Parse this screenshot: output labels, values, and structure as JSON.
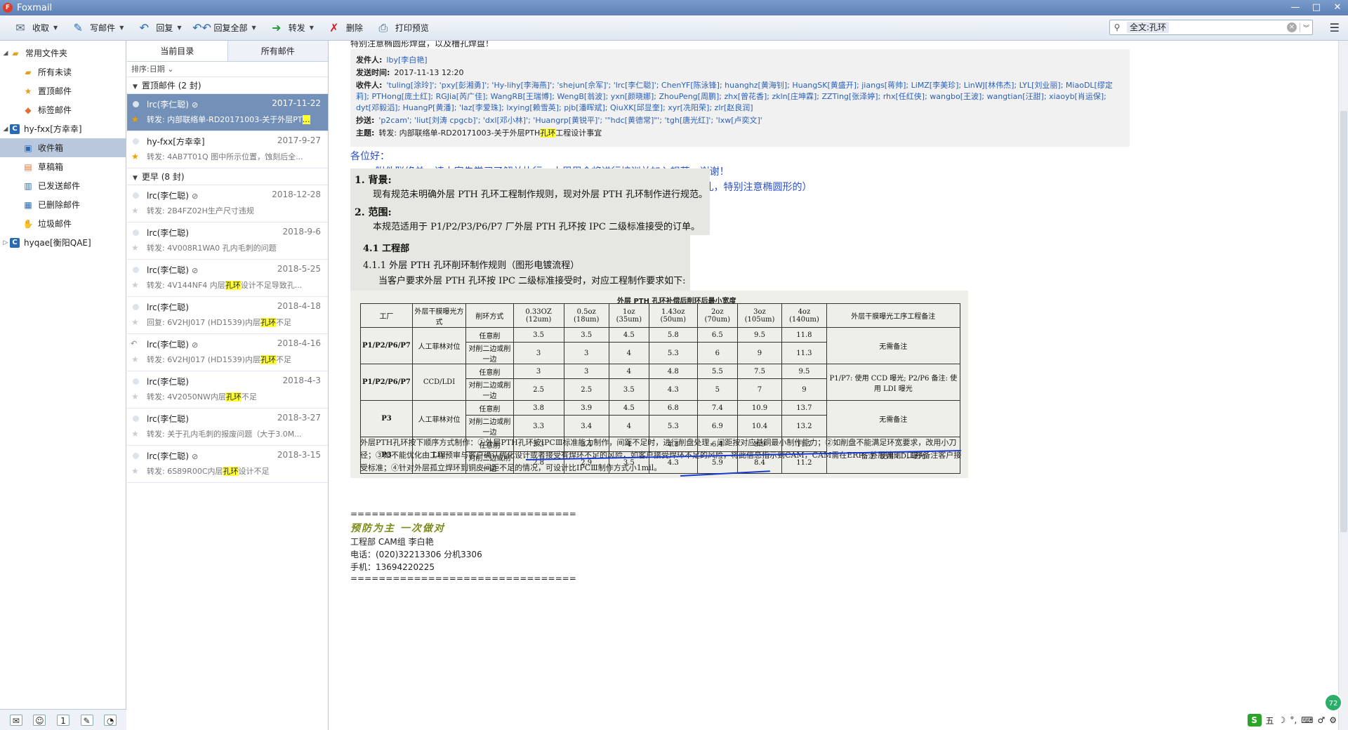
{
  "window": {
    "title": "Foxmail",
    "controls": [
      "—",
      "□",
      "✕"
    ]
  },
  "toolbar": {
    "buttons": [
      {
        "label": "收取",
        "icon": "inbox-receive-icon",
        "dropdown": true
      },
      {
        "label": "写邮件",
        "icon": "compose-pen-icon",
        "dropdown": true
      },
      {
        "label": "回复",
        "icon": "reply-arrow-icon",
        "dropdown": true
      },
      {
        "label": "回复全部",
        "icon": "reply-all-icon",
        "dropdown": true
      },
      {
        "label": "转发",
        "icon": "forward-arrow-icon",
        "dropdown": true
      },
      {
        "label": "删除",
        "icon": "delete-x-icon",
        "dropdown": false
      },
      {
        "label": "打印预览",
        "icon": "print-icon",
        "dropdown": false
      }
    ],
    "search_value": "全文:孔环"
  },
  "sidebar": {
    "items": [
      {
        "label": "常用文件夹",
        "level": 0,
        "icon": "folder-icon",
        "arrow": "◢"
      },
      {
        "label": "所有未读",
        "level": 1,
        "icon": "folder-icon"
      },
      {
        "label": "置顶邮件",
        "level": 1,
        "icon": "star-icon"
      },
      {
        "label": "标签邮件",
        "level": 1,
        "icon": "tag-icon"
      },
      {
        "label": "hy-fxx[方幸幸]",
        "level": 0,
        "icon": "account-icon",
        "arrow": "◢"
      },
      {
        "label": "收件箱",
        "level": 1,
        "icon": "inbox-icon",
        "selected": true
      },
      {
        "label": "草稿箱",
        "level": 1,
        "icon": "drafts-icon"
      },
      {
        "label": "已发送邮件",
        "level": 1,
        "icon": "sent-icon"
      },
      {
        "label": "已删除邮件",
        "level": 1,
        "icon": "trash-icon"
      },
      {
        "label": "垃圾邮件",
        "level": 1,
        "icon": "spam-icon"
      },
      {
        "label": "hyqae[衡阳QAE]",
        "level": 0,
        "icon": "account-icon",
        "arrow": "▷"
      }
    ]
  },
  "list": {
    "tabs": [
      "当前目录",
      "所有邮件"
    ],
    "sort_label": "排序:日期",
    "groups": [
      {
        "label": "置顶邮件 (2 封)",
        "items": [
          {
            "sender": "lrc(李仁聪)",
            "date": "2017-11-22",
            "subject_pre": "转发: 内部联络单-RD20171003-关于外层PT",
            "subject_hl": "…",
            "subject_post": "",
            "attach": true,
            "star": true,
            "selected": true
          },
          {
            "sender": "hy-fxx[方幸幸]",
            "date": "2017-9-27",
            "subject_pre": "转发: 4AB7T01Q 图中所示位置，蚀刻后全...",
            "subject_hl": "",
            "subject_post": "",
            "attach": false,
            "star": true
          }
        ]
      },
      {
        "label": "更早 (8 封)",
        "items": [
          {
            "sender": "lrc(李仁聪)",
            "date": "2018-12-28",
            "subject_pre": "转发: 2B4FZ02H生产尺寸违规",
            "subject_hl": "",
            "subject_post": "",
            "attach": true
          },
          {
            "sender": "lrc(李仁聪)",
            "date": "2018-9-6",
            "subject_pre": "转发: 4V008R1WA0  孔内毛刺的问题",
            "subject_hl": "",
            "subject_post": "",
            "attach": false
          },
          {
            "sender": "lrc(李仁聪)",
            "date": "2018-5-25",
            "subject_pre": "转发: 4V144NF4   内层",
            "subject_hl": "孔环",
            "subject_post": "设计不足导致孔...",
            "attach": true
          },
          {
            "sender": "lrc(李仁聪)",
            "date": "2018-4-18",
            "subject_pre": "回复: 6V2HJ017  (HD1539)内层",
            "subject_hl": "孔环",
            "subject_post": "不足",
            "attach": false
          },
          {
            "sender": "lrc(李仁聪)",
            "date": "2018-4-16",
            "subject_pre": "转发: 6V2HJ017  (HD1539)内层",
            "subject_hl": "孔环",
            "subject_post": "不足",
            "attach": true,
            "replied": true
          },
          {
            "sender": "lrc(李仁聪)",
            "date": "2018-4-3",
            "subject_pre": "转发: 4V2050NW内层",
            "subject_hl": "孔环",
            "subject_post": "不足",
            "attach": false
          },
          {
            "sender": "lrc(李仁聪)",
            "date": "2018-3-27",
            "subject_pre": "转发: 关于孔内毛刺的报废问题（大于3.0M...",
            "subject_hl": "",
            "subject_post": "",
            "attach": false
          },
          {
            "sender": "lrc(李仁聪)",
            "date": "2018-3-15",
            "subject_pre": "转发: 6S89R00C内层",
            "subject_hl": "孔环",
            "subject_post": "设计不足",
            "attach": true
          }
        ]
      }
    ]
  },
  "mail": {
    "cut_line": "特别注意椭圆形焊盘，以及槽孔焊盘！",
    "from_label": "发件人:",
    "from": "lby[李白艳]",
    "time_label": "发送时间:",
    "time": "2017-11-13 12:20",
    "to_label": "收件人:",
    "to": "'tuling[涂玲]'; 'pxy[彭湘勇]'; 'Hy-lihy[李海燕]'; 'shejun[佘军]'; 'lrc[李仁聪]'; ChenYF[陈泳锋]; huanghz[黄海钊]; HuangSK[黄盛开]; jiangs[蒋帅]; LiMZ[李美珍]; LinWJ[林伟杰]; LYL[刘业丽]; MiaoDL[缪定莉]; PTHong[庞土红]; RGJia[芮广佳]; WangRB[王瑞博]; WengB[翁波]; yxn[颜晓娜]; ZhouPeng[周鹏]; zhx[曾花香]; zkln[庄坤霖]; ZZTing[张泽婷]; rhx[任红侠]; wangbo[王波]; wangtian[汪甜]; xiaoyb[肖运保]; dyt[邓毅滔]; HuangP[黄潘]; 'laz[李爱珠]; lxying[赖雪英]; pjb[潘晖斌]; QiuXK[邱显奎]; xyr[冼阳荣]; zlr[赵良润]",
    "cc_label": "抄送:",
    "cc": "'p2cam'; 'liut[刘涛 cpgcb]'; 'dxl[邓小林]'; 'Huangrp[黄锐平]'; '\"hdc[黄德常]\"'; 'tgh[唐光红]'; 'lxw[卢奕文]'",
    "subject_label": "主题:",
    "subject_pre": "转发: 内部联络单-RD20171003-关于外层PTH",
    "subject_hl": "孔环",
    "subject_post": "工程设计事宜",
    "body": [
      "各位好：",
      "        附件联络单，请大家先学习了解并执行。本周周会将进行培训并加入规范。谢谢！",
      "（注意，按联络单要求，如果达不到的，就需要提出确认和评审了，包含所有PTH孔，特别注意椭圆形的）"
    ],
    "doc": {
      "s1_num": "1.",
      "s1_head": "背景:",
      "s1_text": "现有规范未明确外层 PTH 孔环工程制作规则，现对外层 PTH 孔环制作进行规范。",
      "s2_num": "2.",
      "s2_head": "范围:",
      "s2_text": "本规范适用于 P1/P2/P3/P6/P7 厂外层 PTH 孔环按 IPC 二级标准接受的订单。",
      "s41": "4.1  工程部",
      "s411": "4.1.1  外层 PTH 孔环削环制作规则（图形电镀流程）",
      "s411_text": "当客户要求外层 PTH 孔环按 IPC 二级标准接受时，对应工程制作要求如下:"
    },
    "table": {
      "title": "外层 PTH 孔环补偿后削环后最小宽度",
      "headers": [
        "工厂",
        "外层干膜曝光方式",
        "削环方式",
        "0.33OZ (12um)",
        "0.5oz (18um)",
        "1oz (35um)",
        "1.43oz (50um)",
        "2oz (70um)",
        "3oz (105um)",
        "4oz (140um)",
        "外层干膜曝光工序工程备注"
      ],
      "rows": [
        [
          "P1/P2/P6/P7",
          "人工菲林对位",
          "任意削",
          "3.5",
          "3.5",
          "4.5",
          "5.8",
          "6.5",
          "9.5",
          "11.8",
          "无需备注"
        ],
        [
          "",
          "",
          "对削二边或削一边",
          "3",
          "3",
          "4",
          "5.3",
          "6",
          "9",
          "11.3",
          ""
        ],
        [
          "P1/P2/P6/P7",
          "CCD/LDI",
          "任意削",
          "3",
          "3",
          "4",
          "4.8",
          "5.5",
          "7.5",
          "9.5",
          "P1/P7: 使用 CCD 曝光; P2/P6 备注: 使用 LDI 曝光"
        ],
        [
          "",
          "",
          "对削二边或削一边",
          "2.5",
          "2.5",
          "3.5",
          "4.3",
          "5",
          "7",
          "9",
          ""
        ],
        [
          "P3",
          "人工菲林对位",
          "任意削",
          "3.8",
          "3.9",
          "4.5",
          "6.8",
          "7.4",
          "10.9",
          "13.7",
          "无需备注"
        ],
        [
          "",
          "",
          "对削二边或削一边",
          "3.3",
          "3.4",
          "4",
          "5.3",
          "6.9",
          "10.4",
          "13.2",
          ""
        ],
        [
          "P3",
          "LDI",
          "任意削",
          "3.3",
          "3.4",
          "4",
          "4.8",
          "6.4",
          "8.9",
          "11.7",
          "备注: 使用 LDI 曝光"
        ],
        [
          "",
          "",
          "对削二边或削一边",
          "2.8",
          "2.9",
          "3.5",
          "4.3",
          "5.9",
          "8.4",
          "11.2",
          ""
        ]
      ],
      "note": "外层PTH孔环按下顺序方式制作：①外层PTH孔环按IPCⅢ标准能力制作，间距不足时，进行削盘处理，间距按对应基铜最小制作能力；②如削盘不能满足环宽要求，改用小刀径；③如不能优化由工程预审与客户确认优化设计或者接受有焊环不足的风险，如客户接受焊环不足的风险，将此信息指示到CAM，CAM需在ERP “外层蚀刻” 工序备注客户接受标准；④针对外层孤立焊环到铜皮间距不足的情况，可设计比IPCⅢ制作方式小1mil。"
    },
    "signature": {
      "rule": "================================",
      "motto": "预防为主  一次做对",
      "dept": "工程部 CAM组 李白艳",
      "phone": "电话：(020)32213306 分机3306",
      "mobile": "手机：13694220225",
      "rule2": "================================"
    }
  },
  "ime": {
    "logo": "S",
    "items": [
      "五",
      "☽",
      "°,",
      "⌨",
      "♂",
      "⚙"
    ],
    "bubble": "72"
  },
  "colors": {
    "title_bar": "#5d80b6",
    "selected_row": "#7390b8",
    "highlight": "#ffff33",
    "body_text": "#2a50c8"
  }
}
